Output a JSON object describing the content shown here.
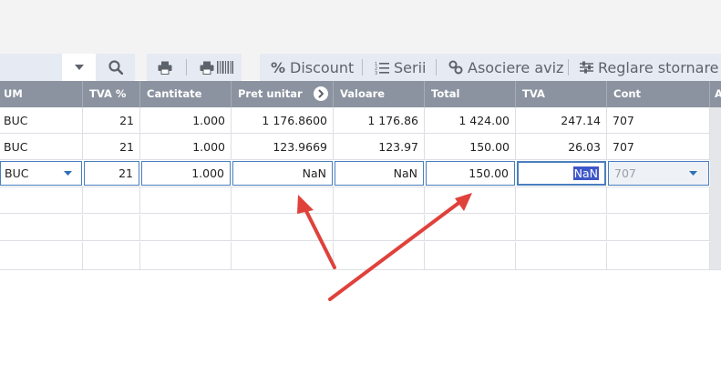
{
  "toolbar": {
    "actions": {
      "discount": "Discount",
      "serii": "Serii",
      "asociere_aviz": "Asociere aviz",
      "reglare_stornare": "Reglare stornare"
    }
  },
  "table": {
    "headers": {
      "um": "UM",
      "tva_pct": "TVA %",
      "cantitate": "Cantitate",
      "pret_unitar": "Pret unitar",
      "valoare": "Valoare",
      "total": "Total",
      "tva": "TVA",
      "cont": "Cont",
      "extra": "A"
    },
    "rows": [
      {
        "um": "BUC",
        "tva_pct": "21",
        "cantitate": "1.000",
        "pret_unitar": "1 176.8600",
        "valoare": "1 176.86",
        "total": "1 424.00",
        "tva": "247.14",
        "cont": "707"
      },
      {
        "um": "BUC",
        "tva_pct": "21",
        "cantitate": "1.000",
        "pret_unitar": "123.9669",
        "valoare": "123.97",
        "total": "150.00",
        "tva": "26.03",
        "cont": "707"
      }
    ],
    "edit_row": {
      "um": "BUC",
      "tva_pct": "21",
      "cantitate": "1.000",
      "pret_unitar": "NaN",
      "valoare": "NaN",
      "total": "150.00",
      "tva": "NaN",
      "cont": "707",
      "extra": "-"
    }
  },
  "colors": {
    "header_bg": "#8b93a0",
    "toolbar_bg": "#e6eaf2",
    "edit_border": "#4a7fbf",
    "selection": "#3d56c8",
    "annotation_arrow": "#e0413b"
  }
}
